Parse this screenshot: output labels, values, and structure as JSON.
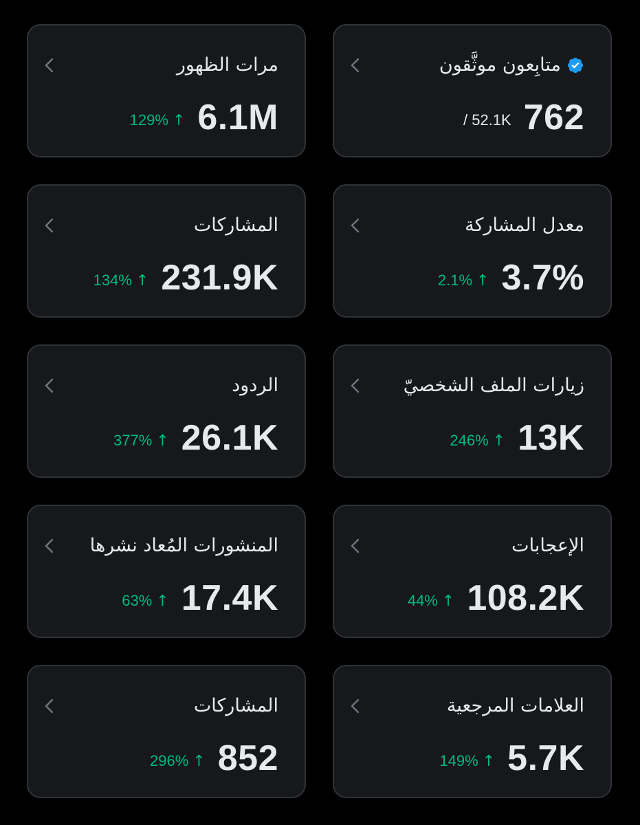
{
  "colors": {
    "background": "#000000",
    "card_background": "#16181c",
    "card_border": "#2f3336",
    "text_primary": "#e7e9ea",
    "chevron": "#71767b",
    "positive": "#00ba7c",
    "verified_badge": "#1d9bf0"
  },
  "cards": {
    "verified_followers": {
      "label": "متابِعون موثَّقون",
      "value": "762",
      "total": "/ 52.1K",
      "icon": "verified-badge-icon"
    },
    "impressions": {
      "label": "مرات الظهور",
      "value": "6.1M",
      "change": "129%",
      "change_arrow": "↑"
    },
    "engagement_rate": {
      "label": "معدل المشاركة",
      "value": "3.7%",
      "change": "2.1%",
      "change_arrow": "↑"
    },
    "engagements": {
      "label": "المشاركات",
      "value": "231.9K",
      "change": "134%",
      "change_arrow": "↑"
    },
    "profile_visits": {
      "label": "زيارات الملف الشخصيّ",
      "value": "13K",
      "change": "246%",
      "change_arrow": "↑"
    },
    "replies": {
      "label": "الردود",
      "value": "26.1K",
      "change": "377%",
      "change_arrow": "↑"
    },
    "likes": {
      "label": "الإعجابات",
      "value": "108.2K",
      "change": "44%",
      "change_arrow": "↑"
    },
    "reposts": {
      "label": "المنشورات المُعاد نشرها",
      "value": "17.4K",
      "change": "63%",
      "change_arrow": "↑"
    },
    "bookmarks": {
      "label": "العلامات المرجعية",
      "value": "5.7K",
      "change": "149%",
      "change_arrow": "↑"
    },
    "shares": {
      "label": "المشاركات",
      "value": "852",
      "change": "296%",
      "change_arrow": "↑"
    }
  }
}
